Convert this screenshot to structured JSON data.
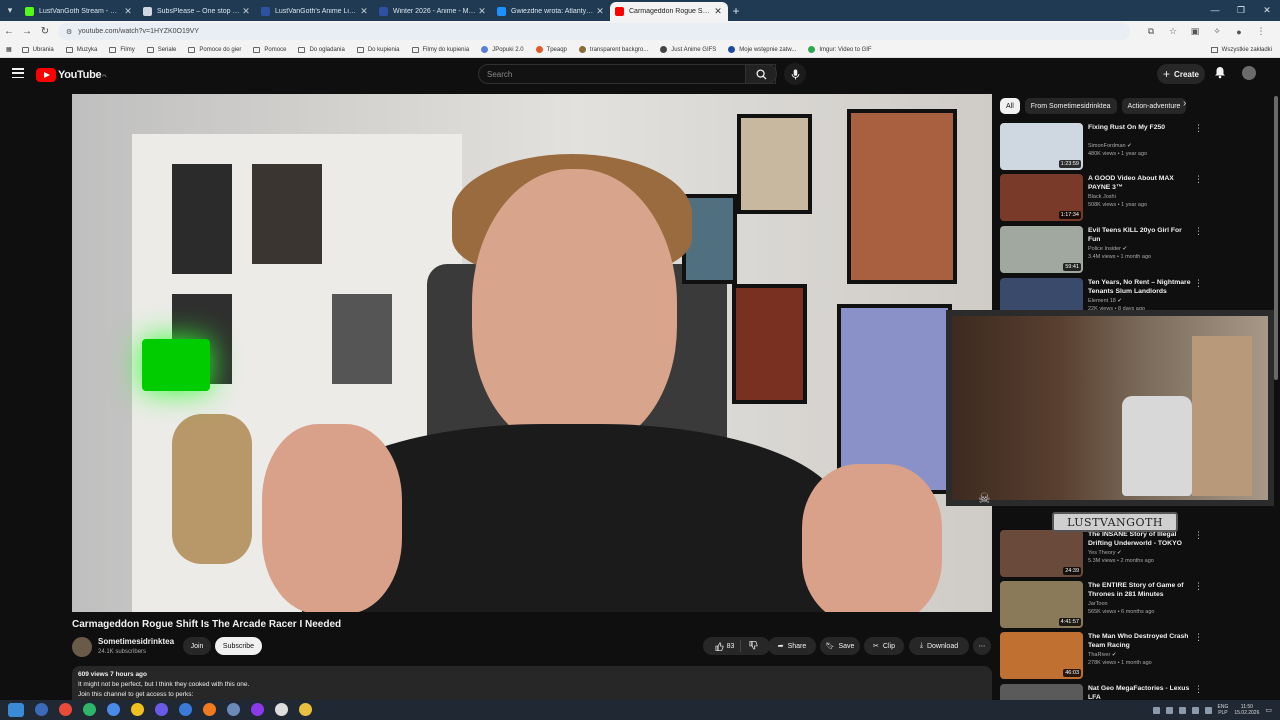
{
  "browser": {
    "tabs": [
      {
        "title": "LustVanGoth Stream - Watch L",
        "color": "#53fc18"
      },
      {
        "title": "SubsPlease – One stop shop fo",
        "color": "#cfd8e0"
      },
      {
        "title": "LustVanGoth's Anime List - My",
        "color": "#2e51a2"
      },
      {
        "title": "Winter 2026 - Anime - MyAnim",
        "color": "#2e51a2"
      },
      {
        "title": "Gwiezdne wrota: Atlantyda / St",
        "color": "#1e90ff"
      },
      {
        "title": "Carmageddon Rogue Shift Is Th",
        "color": "#ff0000"
      }
    ],
    "url": "youtube.com/watch?v=1HYZK0O19VY",
    "bookmarks": [
      {
        "label": "Ubrania",
        "kind": "folder"
      },
      {
        "label": "Muzyka",
        "kind": "folder"
      },
      {
        "label": "Filmy",
        "kind": "folder"
      },
      {
        "label": "Seriale",
        "kind": "folder"
      },
      {
        "label": "Pomoce do gier",
        "kind": "folder"
      },
      {
        "label": "Pomoce",
        "kind": "folder"
      },
      {
        "label": "Do ogladania",
        "kind": "folder"
      },
      {
        "label": "Do kupienia",
        "kind": "folder"
      },
      {
        "label": "Filmy do kupienia",
        "kind": "folder"
      },
      {
        "label": "JPopuki 2.0",
        "kind": "site",
        "color": "#5a7dd6"
      },
      {
        "label": "Tpeaqp",
        "kind": "site",
        "color": "#e05a2a"
      },
      {
        "label": "transparent backgro...",
        "kind": "site",
        "color": "#8a6a3a"
      },
      {
        "label": "Just Anime GIFS",
        "kind": "site",
        "color": "#444444"
      },
      {
        "label": "Moje wstępnie zatw...",
        "kind": "site",
        "color": "#1e4aa0"
      },
      {
        "label": "Imgur: Video to GIF",
        "kind": "site",
        "color": "#2fa84f"
      }
    ],
    "all_bookmarks": "Wszystkie zakładki"
  },
  "youtube": {
    "logo_text": "YouTube",
    "region": "PL",
    "search_placeholder": "Search",
    "create_label": "Create"
  },
  "video": {
    "title": "Carmageddon Rogue Shift Is The Arcade Racer I Needed",
    "channel": "Sometimesidrinktea",
    "subscribers": "24.1K subscribers",
    "join_label": "Join",
    "subscribe_label": "Subscribe",
    "likes": "83",
    "share_label": "Share",
    "save_label": "Save",
    "clip_label": "Clip",
    "download_label": "Download",
    "stats": "609 views  7 hours ago",
    "description_line1": "It might not be perfect, but I think they cooked with this one.",
    "description_line2": "Join this channel to get access to perks:"
  },
  "sidebar": {
    "chips": [
      "All",
      "From Sometimesidrinktea",
      "Action-adventure"
    ],
    "recommendations": [
      {
        "title": "Fixing Rust On My F250",
        "channel": "SimonFordman",
        "verified": true,
        "views": "480K views • 1 year ago",
        "duration": "1:23:59",
        "thumb": "#cfd8e0"
      },
      {
        "title": "A GOOD Video About MAX PAYNE 3™",
        "channel": "Black Joshi",
        "verified": false,
        "views": "508K views • 1 year ago",
        "duration": "1:17:34",
        "thumb": "#7a3a2a"
      },
      {
        "title": "Evil Teens KILL 20yo Girl For Fun",
        "channel": "Police Insider",
        "verified": true,
        "views": "3.4M views • 1 month ago",
        "duration": "59:41",
        "thumb": "#a0a8a0"
      },
      {
        "title": "Ten Years, No Rent – Nightmare Tenants Slum Landlords",
        "channel": "Element 18",
        "verified": true,
        "views": "22K views • 8 days ago",
        "duration": "",
        "thumb": "#3a4a6a"
      },
      {
        "title": "The INSANE Story of Illegal Drifting Underworld - TOKYO DRIFT",
        "channel": "Yes Theory",
        "verified": true,
        "views": "5.3M views • 2 months ago",
        "duration": "24:39",
        "thumb": "#6a4a3a"
      },
      {
        "title": "The ENTIRE Story of Game of Thrones in 281 Minutes",
        "channel": "JarToon",
        "verified": false,
        "views": "565K views • 6 months ago",
        "duration": "4:41:57",
        "thumb": "#8a7a5a"
      },
      {
        "title": "The Man Who Destroyed Crash Team Racing",
        "channel": "ThaRiver",
        "verified": true,
        "views": "278K views • 1 month ago",
        "duration": "46:03",
        "thumb": "#c07030"
      },
      {
        "title": "Nat Geo MegaFactories - Lexus LFA",
        "channel": "",
        "verified": false,
        "views": "",
        "duration": "",
        "thumb": "#5a5a5a"
      }
    ]
  },
  "overlay": {
    "name_plate": "LUSTVANGOTH"
  },
  "taskbar": {
    "icons": [
      "#3a6ab8",
      "#e84b3a",
      "#2fb56a",
      "#4a8ae8",
      "#f0c020",
      "#6a5ae8",
      "#3a7ad8",
      "#f07a20",
      "#6a8ab8",
      "#8a3ae8",
      "#dddddd",
      "#e8c040"
    ],
    "lang_top": "ENG",
    "lang_bottom": "PLP",
    "time": "11:50",
    "date": "15.02.2026"
  }
}
